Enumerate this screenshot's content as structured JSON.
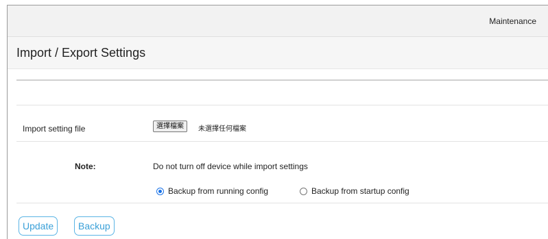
{
  "header": {
    "breadcrumb": "Maintenance"
  },
  "page": {
    "title": "Import / Export Settings"
  },
  "import_row": {
    "label": "Import setting file",
    "choose_file_button": "選擇檔案",
    "file_status": "未選擇任何檔案"
  },
  "note_row": {
    "label": "Note:",
    "text": "Do not turn off device while import settings"
  },
  "backup_options": [
    {
      "label": "Backup from running config",
      "selected": true
    },
    {
      "label": "Backup from startup config",
      "selected": false
    }
  ],
  "actions": {
    "update_label": "Update",
    "backup_label": "Backup"
  },
  "colors": {
    "accent": "#3aa0d8",
    "radio_selected": "#1a73e8"
  }
}
